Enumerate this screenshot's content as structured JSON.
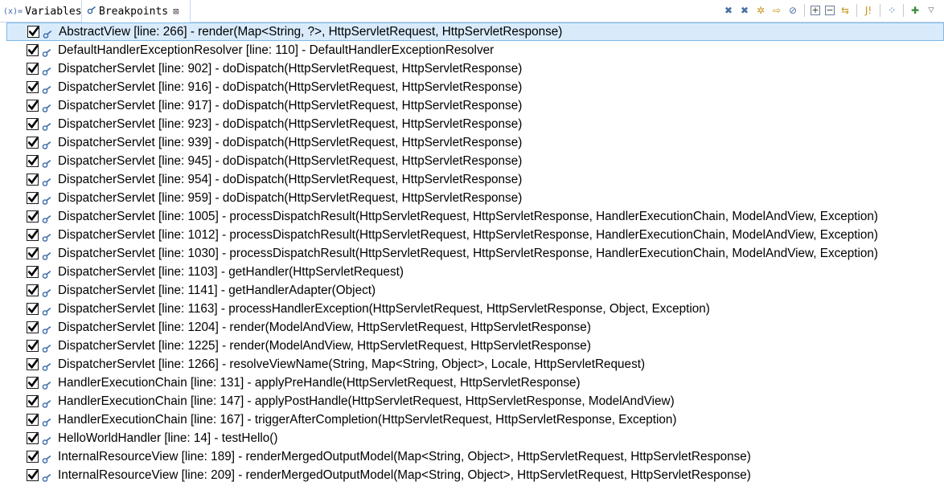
{
  "tabs": [
    {
      "label": "Variables",
      "icon": "variables-icon",
      "active": false
    },
    {
      "label": "Breakpoints",
      "icon": "breakpoint-icon",
      "active": true
    }
  ],
  "toolbar": {
    "items": [
      "remove-selected-breakpoints-icon",
      "remove-all-breakpoints-icon",
      "show-supported-breakpoints-icon",
      "go-to-file-icon",
      "skip-all-breakpoints-icon",
      "expand-all-icon",
      "collapse-all-icon",
      "link-with-debug-view-icon",
      "add-java-exception-breakpoint-icon",
      "import-breakpoints-icon",
      "add-breakpoint-icon",
      "view-menu-icon"
    ]
  },
  "breakpoints": [
    {
      "label": "AbstractView [line: 266] - render(Map<String, ?>, HttpServletRequest, HttpServletResponse)",
      "checked": true,
      "selected": true
    },
    {
      "label": "DefaultHandlerExceptionResolver [line: 110] - DefaultHandlerExceptionResolver",
      "checked": true
    },
    {
      "label": "DispatcherServlet [line: 902] - doDispatch(HttpServletRequest, HttpServletResponse)",
      "checked": true
    },
    {
      "label": "DispatcherServlet [line: 916] - doDispatch(HttpServletRequest, HttpServletResponse)",
      "checked": true
    },
    {
      "label": "DispatcherServlet [line: 917] - doDispatch(HttpServletRequest, HttpServletResponse)",
      "checked": true
    },
    {
      "label": "DispatcherServlet [line: 923] - doDispatch(HttpServletRequest, HttpServletResponse)",
      "checked": true
    },
    {
      "label": "DispatcherServlet [line: 939] - doDispatch(HttpServletRequest, HttpServletResponse)",
      "checked": true
    },
    {
      "label": "DispatcherServlet [line: 945] - doDispatch(HttpServletRequest, HttpServletResponse)",
      "checked": true
    },
    {
      "label": "DispatcherServlet [line: 954] - doDispatch(HttpServletRequest, HttpServletResponse)",
      "checked": true
    },
    {
      "label": "DispatcherServlet [line: 959] - doDispatch(HttpServletRequest, HttpServletResponse)",
      "checked": true
    },
    {
      "label": "DispatcherServlet [line: 1005] - processDispatchResult(HttpServletRequest, HttpServletResponse, HandlerExecutionChain, ModelAndView, Exception)",
      "checked": true
    },
    {
      "label": "DispatcherServlet [line: 1012] - processDispatchResult(HttpServletRequest, HttpServletResponse, HandlerExecutionChain, ModelAndView, Exception)",
      "checked": true
    },
    {
      "label": "DispatcherServlet [line: 1030] - processDispatchResult(HttpServletRequest, HttpServletResponse, HandlerExecutionChain, ModelAndView, Exception)",
      "checked": true
    },
    {
      "label": "DispatcherServlet [line: 1103] - getHandler(HttpServletRequest)",
      "checked": true
    },
    {
      "label": "DispatcherServlet [line: 1141] - getHandlerAdapter(Object)",
      "checked": true
    },
    {
      "label": "DispatcherServlet [line: 1163] - processHandlerException(HttpServletRequest, HttpServletResponse, Object, Exception)",
      "checked": true
    },
    {
      "label": "DispatcherServlet [line: 1204] - render(ModelAndView, HttpServletRequest, HttpServletResponse)",
      "checked": true
    },
    {
      "label": "DispatcherServlet [line: 1225] - render(ModelAndView, HttpServletRequest, HttpServletResponse)",
      "checked": true
    },
    {
      "label": "DispatcherServlet [line: 1266] - resolveViewName(String, Map<String, Object>, Locale, HttpServletRequest)",
      "checked": true
    },
    {
      "label": "HandlerExecutionChain [line: 131] - applyPreHandle(HttpServletRequest, HttpServletResponse)",
      "checked": true
    },
    {
      "label": "HandlerExecutionChain [line: 147] - applyPostHandle(HttpServletRequest, HttpServletResponse, ModelAndView)",
      "checked": true
    },
    {
      "label": "HandlerExecutionChain [line: 167] - triggerAfterCompletion(HttpServletRequest, HttpServletResponse, Exception)",
      "checked": true
    },
    {
      "label": "HelloWorldHandler [line: 14] - testHello()",
      "checked": true
    },
    {
      "label": "InternalResourceView [line: 189] - renderMergedOutputModel(Map<String, Object>, HttpServletRequest, HttpServletResponse)",
      "checked": true
    },
    {
      "label": "InternalResourceView [line: 209] - renderMergedOutputModel(Map<String, Object>, HttpServletRequest, HttpServletResponse)",
      "checked": true
    }
  ],
  "colors": {
    "selection_bg": "#d9ebfb",
    "selection_border": "#7db9e8",
    "tab_border": "#c8d7ec"
  }
}
